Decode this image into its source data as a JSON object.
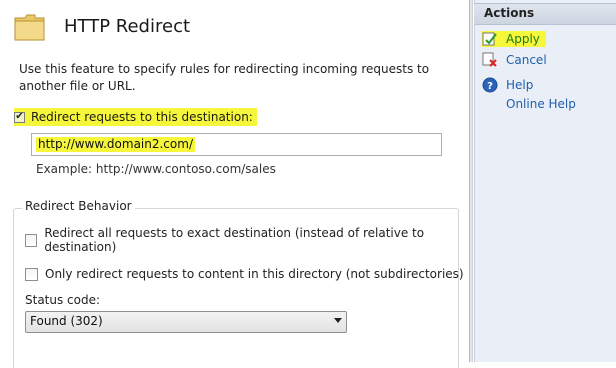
{
  "header": {
    "title": "HTTP Redirect",
    "description": "Use this feature to specify rules for redirecting incoming requests to another file or URL."
  },
  "redirect": {
    "checkbox_label": "Redirect requests to this destination:",
    "checked": true,
    "destination_value": "http://www.domain2.com/",
    "example": "Example: http://www.contoso.com/sales"
  },
  "behavior": {
    "group_title": "Redirect Behavior",
    "option_exact": "Redirect all requests to exact destination (instead of relative to destination)",
    "option_exact_checked": false,
    "option_directory": "Only redirect requests to content in this directory (not subdirectories)",
    "option_directory_checked": false,
    "status_label": "Status code:",
    "status_value": "Found (302)"
  },
  "actions": {
    "title": "Actions",
    "apply": "Apply",
    "cancel": "Cancel",
    "help": "Help",
    "online_help": "Online Help"
  },
  "colors": {
    "highlight": "#f6f63a",
    "link": "#1f5fad",
    "actions_bg": "#e9eef7"
  }
}
